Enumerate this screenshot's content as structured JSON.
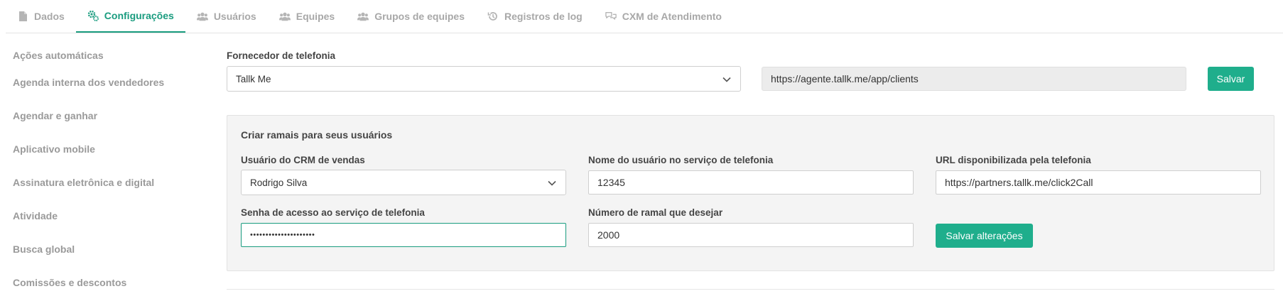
{
  "tabs": [
    {
      "label": "Dados",
      "icon": "document-icon"
    },
    {
      "label": "Configurações",
      "icon": "gears-icon"
    },
    {
      "label": "Usuários",
      "icon": "users-icon"
    },
    {
      "label": "Equipes",
      "icon": "users-icon"
    },
    {
      "label": "Grupos de equipes",
      "icon": "users-icon"
    },
    {
      "label": "Registros de log",
      "icon": "history-icon"
    },
    {
      "label": "CXM de Atendimento",
      "icon": "chat-bubbles-icon"
    }
  ],
  "sidebar": {
    "items": [
      "Ações automáticas",
      "Agenda interna dos vendedores",
      "Agendar e ganhar",
      "Aplicativo mobile",
      "Assinatura eletrônica e digital",
      "Atividade",
      "Busca global",
      "Comissões e descontos"
    ]
  },
  "provider": {
    "label": "Fornecedor de telefonia",
    "selected": "Tallk Me",
    "url": "https://agente.tallk.me/app/clients",
    "save_label": "Salvar"
  },
  "extensions": {
    "title": "Criar ramais para seus usuários",
    "crm_user_label": "Usuário do CRM de vendas",
    "crm_user_value": "Rodrigo Silva",
    "service_user_label": "Nome do usuário no serviço de telefonia",
    "service_user_value": "12345",
    "url_label": "URL disponibilizada pela telefonia",
    "url_value": "https://partners.tallk.me/click2Call",
    "password_label": "Senha de acesso ao serviço de telefonia",
    "password_value": "•••••••••••••••••••••",
    "extension_label": "Número de ramal que desejar",
    "extension_value": "2000",
    "save_changes_label": "Salvar alterações"
  },
  "colors": {
    "accent": "#1a9c7f",
    "button": "#1fae8c",
    "muted_text": "#a8a8a8"
  }
}
